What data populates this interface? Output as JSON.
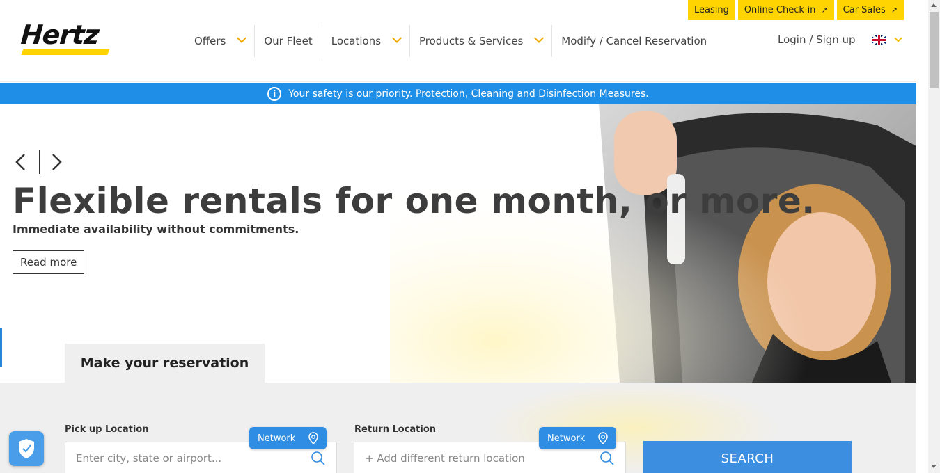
{
  "util_links": [
    {
      "label": "Leasing",
      "external": false
    },
    {
      "label": "Online Check-in",
      "external": true
    },
    {
      "label": "Car Sales",
      "external": true
    }
  ],
  "logo": {
    "text": "Hertz"
  },
  "nav": {
    "items": [
      {
        "label": "Offers"
      },
      {
        "label": "Our Fleet"
      },
      {
        "label": "Locations"
      },
      {
        "label": "Products & Services"
      },
      {
        "label": "Modify / Cancel Reservation"
      }
    ],
    "login": "Login / Sign up"
  },
  "safety_banner": {
    "text": "Your safety is our priority. Protection, Cleaning and Disinfection Measures."
  },
  "hero": {
    "title": "Flexible rentals for one month, or more.",
    "subtitle": "Immediate availability without commitments.",
    "read_more": "Read more"
  },
  "reservation": {
    "tab_label": "Make your reservation",
    "pickup": {
      "label": "Pick up Location",
      "placeholder": "Enter city, state or airport..."
    },
    "return": {
      "label": "Return Location",
      "placeholder": "+ Add different return location"
    },
    "network_label": "Network",
    "search_label": "SEARCH"
  },
  "colors": {
    "brand_yellow": "#ffd400",
    "accent_blue": "#1f8ee6"
  }
}
